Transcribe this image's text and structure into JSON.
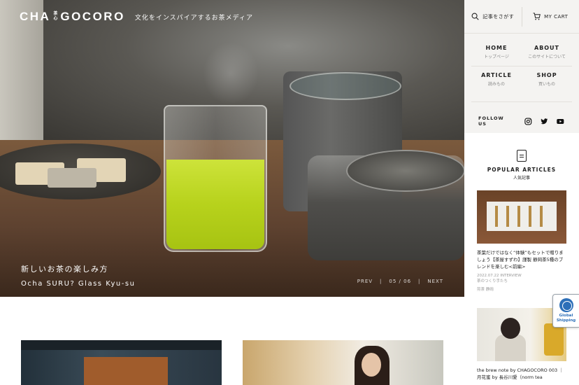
{
  "header": {
    "logo_left": "CHA",
    "logo_mid_top": "茶",
    "logo_mid_bottom": "心",
    "logo_right": "GOCORO",
    "tagline": "文化をインスパイアするお茶メディア"
  },
  "hero": {
    "title_ja": "新しいお茶の楽しみ方",
    "title_en": "Ocha SURU? Glass Kyu-su",
    "prev": "PREV",
    "counter": "05 / 06",
    "next": "NEXT",
    "sep": "|"
  },
  "sidebar": {
    "search_label": "記事をさがす",
    "cart_label": "MY CART",
    "nav": [
      {
        "en": "HOME",
        "ja": "トップページ"
      },
      {
        "en": "ABOUT",
        "ja": "このサイトについて"
      },
      {
        "en": "ARTICLE",
        "ja": "読みもの"
      },
      {
        "en": "SHOP",
        "ja": "買いもの"
      }
    ],
    "follow_label": "FOLLOW US",
    "social_icons": [
      "instagram-icon",
      "twitter-icon",
      "youtube-icon"
    ]
  },
  "popular": {
    "heading_en": "POPULAR ARTICLES",
    "heading_ja": "人気記事",
    "articles": [
      {
        "title": "茶葉だけではなく“体験”もセットで贈りましょう【茶屋すずわ】謹製 静岡茶5種のブレンドを楽しむ<前編>",
        "meta": "2022.07.22 INTERVIEW",
        "sub": "茶のつくり手たち",
        "tags": "煎茶 静岡"
      },
      {
        "title": "the brew note by CHAGOCORO 003 ｜月花蜜 by 長谷川愛（norm tea"
      }
    ]
  },
  "shipping": {
    "line1": "Global",
    "line2": "Shipping"
  },
  "colors": {
    "tea_green": "#b7d21c",
    "sidebar_bg": "#f4f3f1",
    "shipping_blue": "#2d6fb8"
  }
}
